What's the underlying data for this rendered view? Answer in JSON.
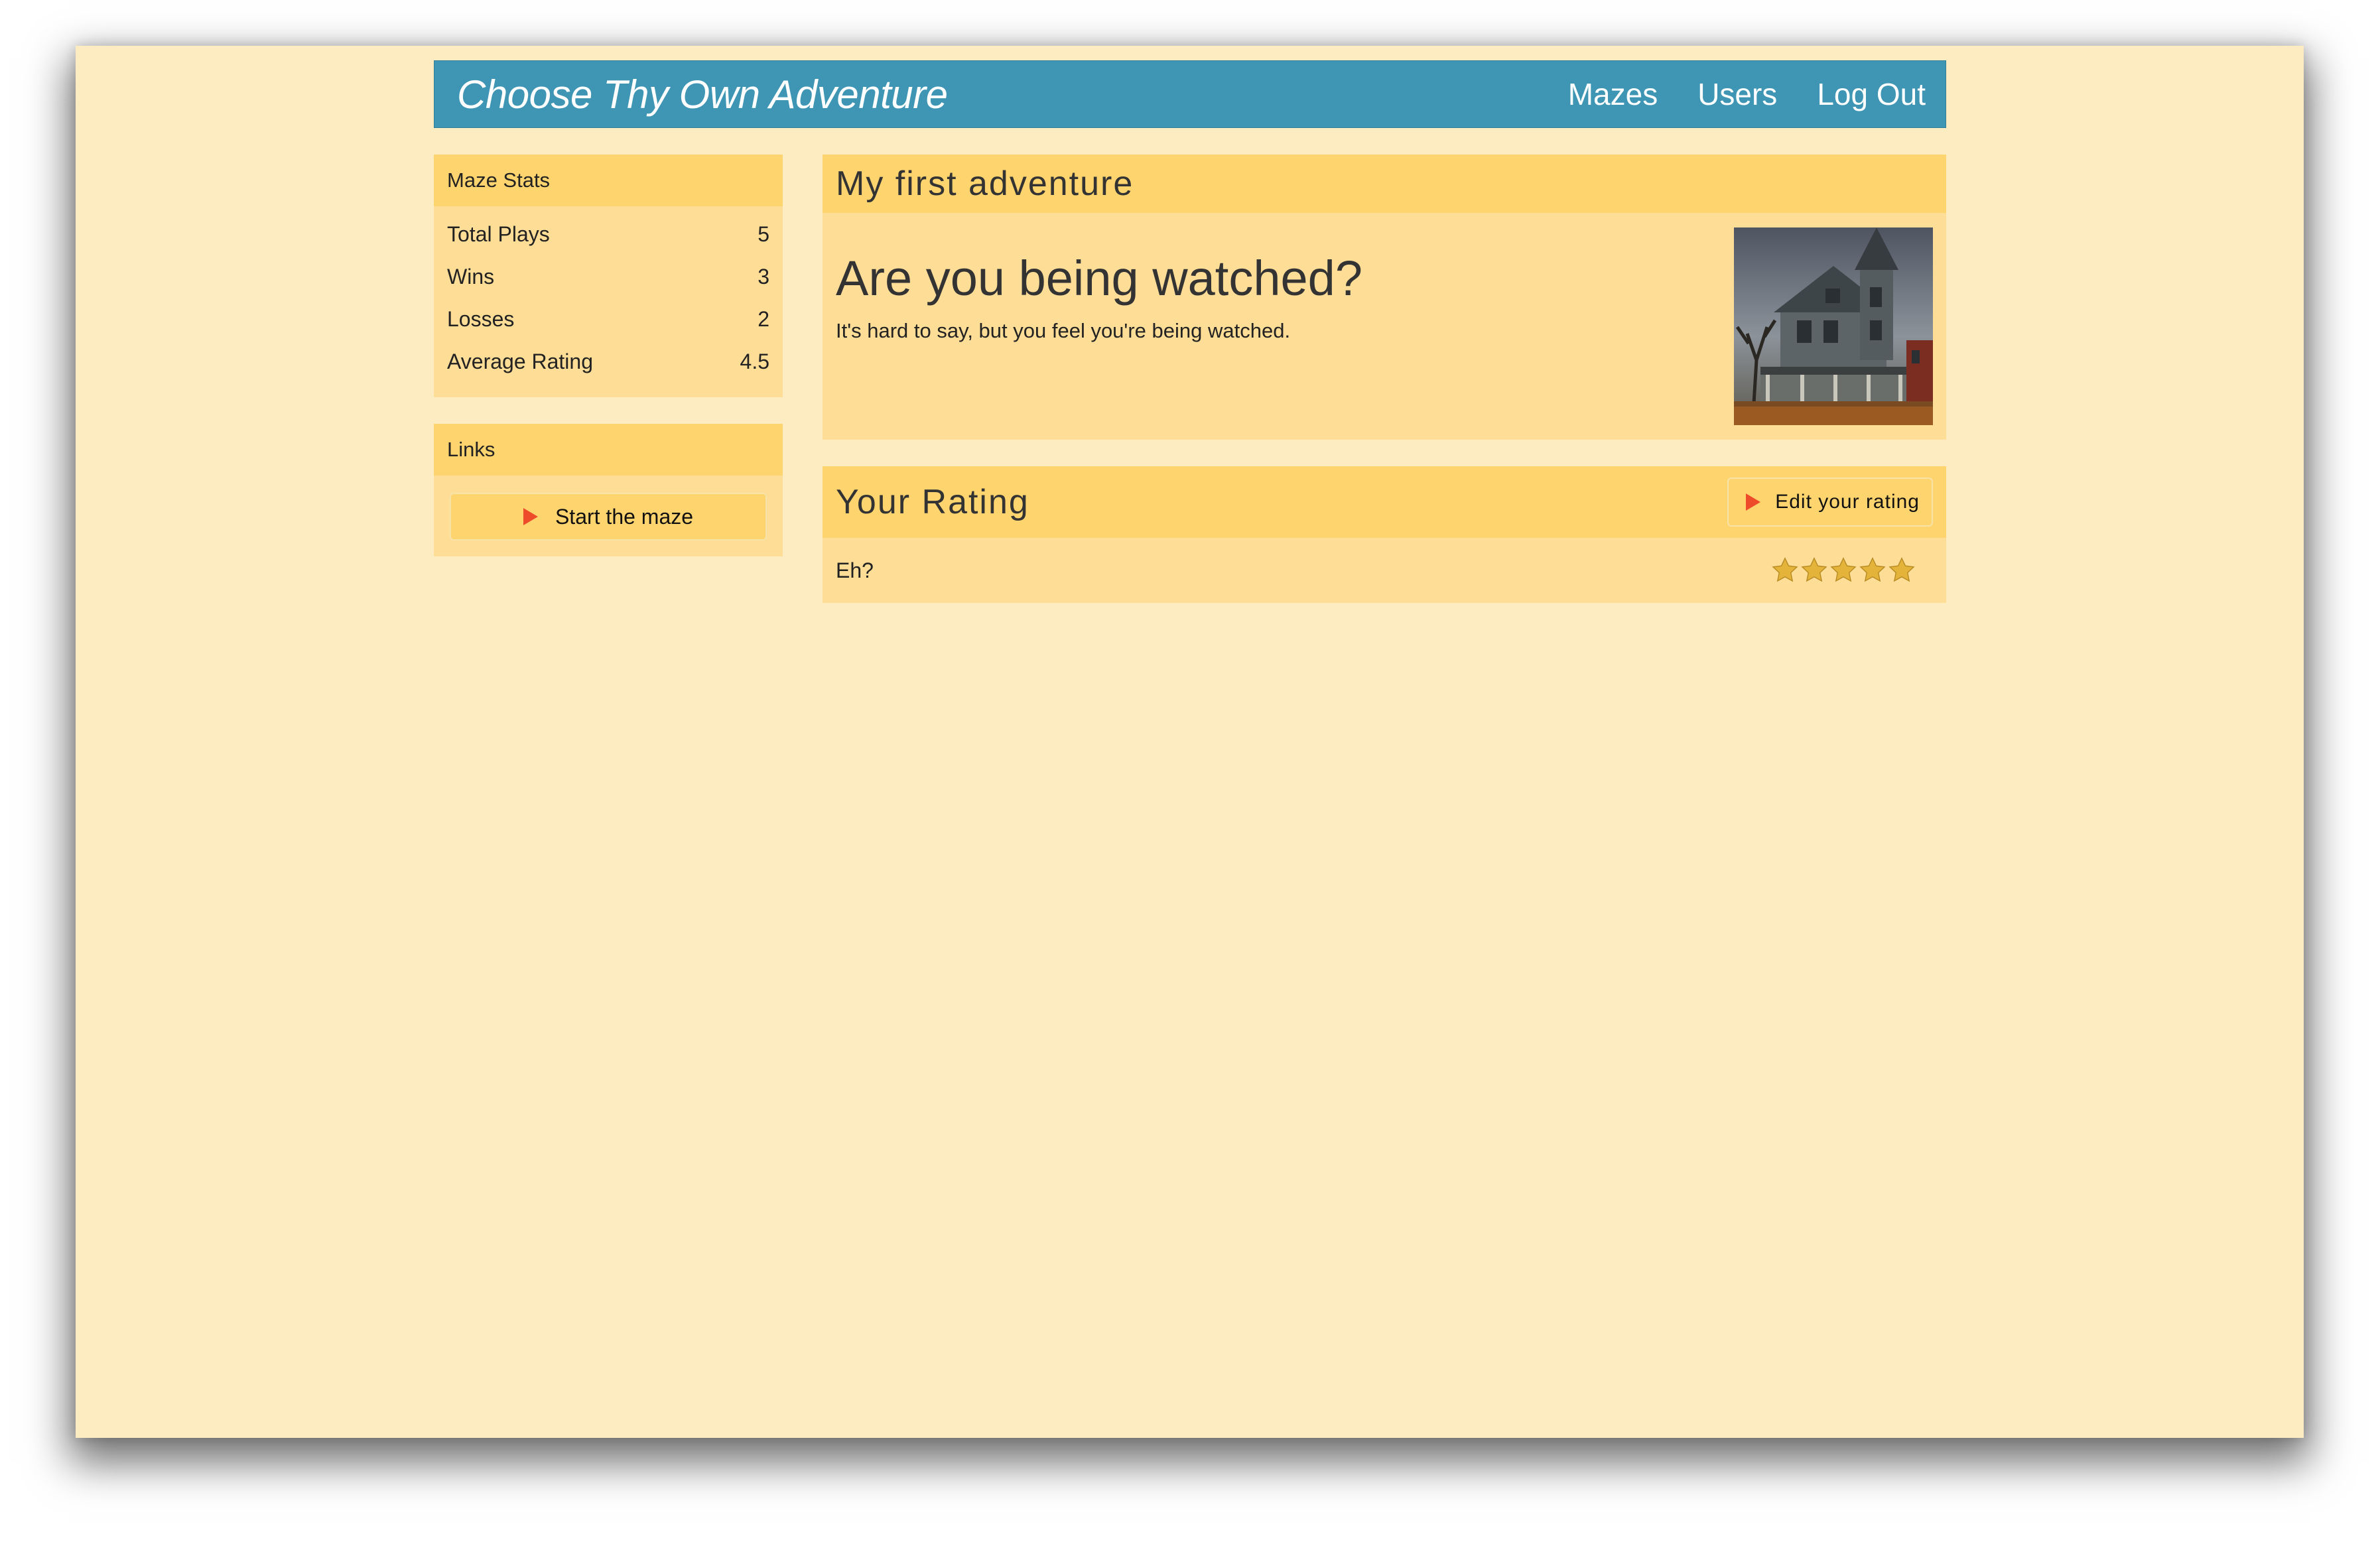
{
  "header": {
    "brand": "Choose Thy Own Adventure",
    "nav": [
      "Mazes",
      "Users",
      "Log Out"
    ]
  },
  "sidebar": {
    "stats_panel": {
      "title": "Maze Stats",
      "rows": [
        {
          "label": "Total Plays",
          "value": "5"
        },
        {
          "label": "Wins",
          "value": "3"
        },
        {
          "label": "Losses",
          "value": "2"
        },
        {
          "label": "Average Rating",
          "value": "4.5"
        }
      ]
    },
    "links_panel": {
      "title": "Links",
      "start_button": "Start the maze"
    }
  },
  "main": {
    "adventure": {
      "title": "My first adventure",
      "question": "Are you being watched?",
      "description": "It's hard to say, but you feel you're being watched.",
      "image_icon": "haunted-house-image"
    },
    "rating": {
      "title": "Your Rating",
      "edit_button": "Edit your rating",
      "text": "Eh?",
      "stars_filled": 5,
      "stars_total": 5
    }
  },
  "colors": {
    "page_bg": "#fdebc2",
    "header_bg": "#3e96b4",
    "panel_bg": "#fedd97",
    "panel_title_bg": "#fed46f",
    "play_icon": "#ee4b2b",
    "star": "#e4b43a"
  }
}
